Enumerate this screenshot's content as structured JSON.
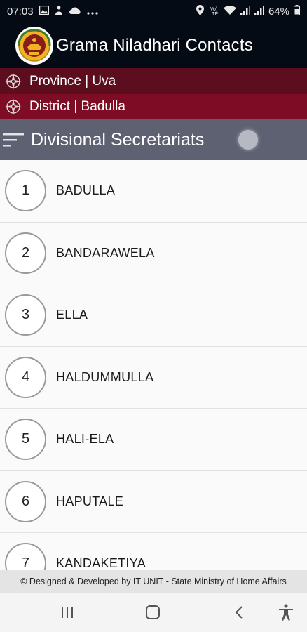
{
  "status_bar": {
    "time": "07:03",
    "battery": "64%",
    "icons": [
      "image-icon",
      "notification-icon",
      "cloud-icon",
      "more-dots-icon",
      "location-icon",
      "volte-icon",
      "wifi-icon",
      "signal-icon",
      "signal-icon",
      "battery-icon"
    ],
    "volte": "Vo) LTE"
  },
  "app_bar": {
    "title": "Grama Niladhari Contacts",
    "logo": "national-emblem-icon"
  },
  "breadcrumbs": {
    "province": "Province | Uva",
    "district": "District | Badulla"
  },
  "section": {
    "title": "Divisional Secretariats"
  },
  "list": [
    {
      "number": "1",
      "name": "BADULLA"
    },
    {
      "number": "2",
      "name": "BANDARAWELA"
    },
    {
      "number": "3",
      "name": "ELLA"
    },
    {
      "number": "4",
      "name": "HALDUMMULLA"
    },
    {
      "number": "5",
      "name": "HALI-ELA"
    },
    {
      "number": "6",
      "name": "HAPUTALE"
    },
    {
      "number": "7",
      "name": "KANDAKETIYA"
    }
  ],
  "footer": {
    "text": "© Designed & Developed by IT UNIT - State Ministry of Home Affairs"
  },
  "colors": {
    "app_bar_bg": "#050b14",
    "province_bg": "#5c0e1e",
    "district_bg": "#7e0c24",
    "section_bg": "#5e6172"
  }
}
